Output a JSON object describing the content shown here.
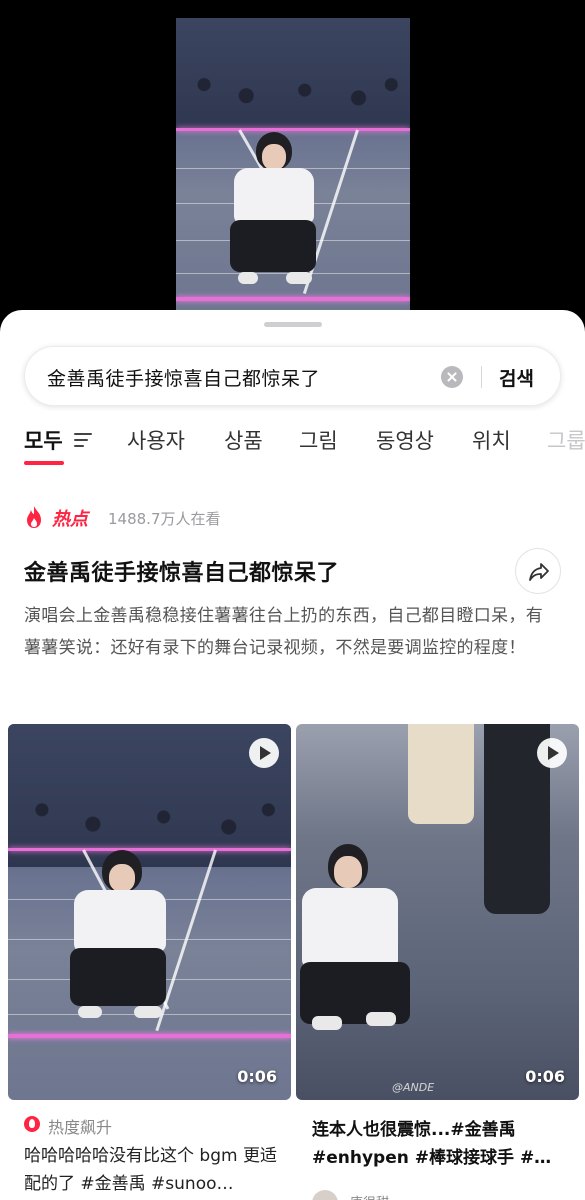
{
  "search": {
    "query": "金善禹徒手接惊喜自己都惊呆了",
    "button_label": "검색"
  },
  "tabs": [
    {
      "label": "모두",
      "active": true
    },
    {
      "label": "사용자"
    },
    {
      "label": "상품"
    },
    {
      "label": "그림"
    },
    {
      "label": "동영상"
    },
    {
      "label": "위치"
    },
    {
      "label": "그룹"
    }
  ],
  "hot_topic": {
    "hot_label": "热点",
    "view_count": "1488.7万人在看",
    "title": "金善禹徒手接惊喜自己都惊呆了",
    "description": "演唱会上金善禹稳稳接住薯薯往台上扔的东西，自己都目瞪口呆，有薯薯笑说：还好有录下的舞台记录视频，不然是要调监控的程度！"
  },
  "cards": [
    {
      "duration": "0:06",
      "badge": "热度飙升",
      "title": "哈哈哈哈哈没有比这个 bgm 更适配的了 #金善禹 #sunoo…"
    },
    {
      "duration": "0:06",
      "watermark": "@ANDE",
      "title": "连本人也很震惊...#金善禹 #enhypen #棒球接球手 #…",
      "author": "唐很甜"
    }
  ],
  "colors": {
    "accent": "#ff2442",
    "stage_pink": "#e86fd6"
  },
  "icons": [
    "clear-icon",
    "filter-icon",
    "flame-icon",
    "share-icon",
    "play-icon",
    "fire-badge-icon"
  ]
}
